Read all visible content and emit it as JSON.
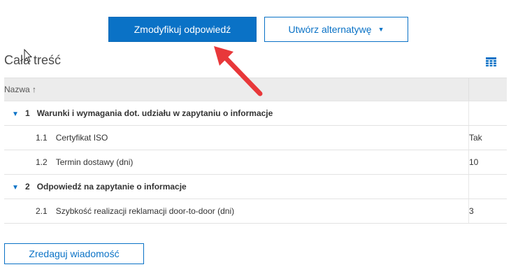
{
  "toolbar": {
    "modify_label": "Zmodyfikuj odpowiedź",
    "alternative_label": "Utwórz alternatywę",
    "alternative_caret": "▼"
  },
  "section": {
    "title": "Cała treść"
  },
  "table": {
    "header_name": "Nazwa ↑",
    "groups": [
      {
        "num": "1",
        "label": "Warunki i wymagania dot. udziału w zapytaniu o informacje",
        "expand_glyph": "▼",
        "items": [
          {
            "num": "1.1",
            "label": "Certyfikat ISO",
            "value": "Tak"
          },
          {
            "num": "1.2",
            "label": "Termin dostawy (dni)",
            "value": "10"
          }
        ]
      },
      {
        "num": "2",
        "label": "Odpowiedź na zapytanie o informacje",
        "expand_glyph": "▼",
        "items": [
          {
            "num": "2.1",
            "label": "Szybkość realizacji reklamacji door-to-door (dni)",
            "value": "3"
          }
        ]
      }
    ]
  },
  "footer": {
    "edit_message_label": "Zredaguj wiadomość"
  },
  "icons": {
    "grid": "table-grid-icon",
    "cursor": "mouse-cursor-icon",
    "annotation": "red-arrow-annotation"
  },
  "colors": {
    "accent": "#0a72c6",
    "annotation": "#e8383a",
    "header_bg": "#ececec"
  }
}
